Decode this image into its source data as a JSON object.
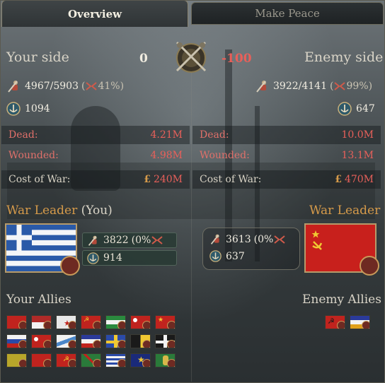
{
  "tabs": {
    "overview": "Overview",
    "make_peace": "Make Peace"
  },
  "your_side": {
    "title": "Your side",
    "score": "0",
    "army": "4967/5903",
    "army_morale": "41%",
    "navy": "1094",
    "dead": {
      "label": "Dead:",
      "value": "4.21M"
    },
    "wounded": {
      "label": "Wounded:",
      "value": "4.98M"
    },
    "cost": {
      "label": "Cost of War:",
      "currency": "£",
      "value": "240M"
    },
    "leader_title": "War Leader",
    "leader_suffix": "(You)",
    "leader_army": "3822",
    "leader_army_pct": "(0%",
    "leader_navy": "914",
    "allies_title": "Your Allies"
  },
  "enemy_side": {
    "title": "Enemy side",
    "score": "-100",
    "army": "3922/4141",
    "army_morale": "99%)",
    "navy": "647",
    "dead": {
      "label": "Dead:",
      "value": "10.0M"
    },
    "wounded": {
      "label": "Wounded:",
      "value": "13.1M"
    },
    "cost": {
      "label": "Cost of War:",
      "currency": "£",
      "value": "470M"
    },
    "leader_title": "War Leader",
    "leader_army": "3613",
    "leader_army_pct": "(0%",
    "leader_navy": "637",
    "allies_title": "Enemy Allies"
  },
  "colors": {
    "accent_gold": "#d59a4a",
    "negative_red": "#e8605a",
    "text_light": "#f0ece0"
  }
}
